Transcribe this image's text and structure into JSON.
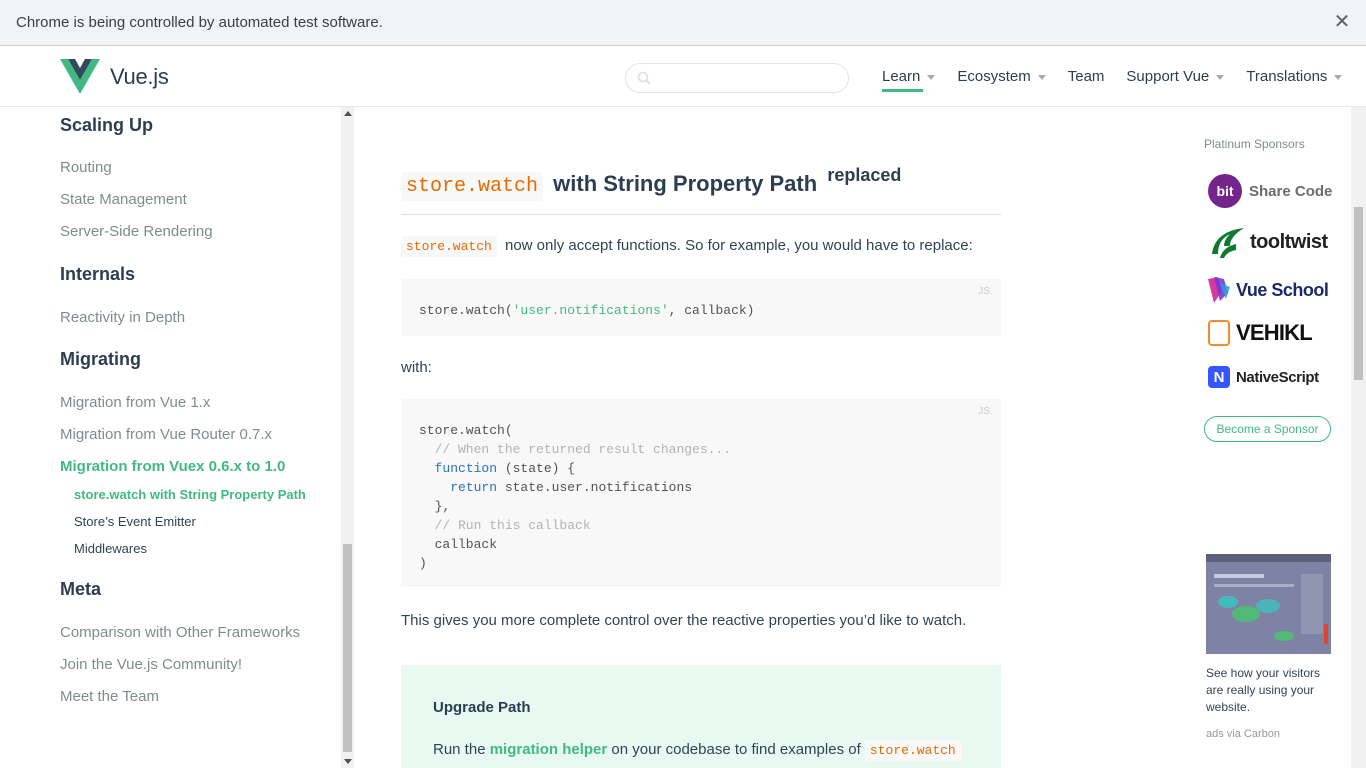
{
  "infobar": {
    "message": "Chrome is being controlled by automated test software.",
    "close": "✕"
  },
  "header": {
    "logo_text": "Vue.js",
    "search_placeholder": "",
    "nav": [
      {
        "label": "Learn",
        "has_dropdown": true,
        "active": true
      },
      {
        "label": "Ecosystem",
        "has_dropdown": true
      },
      {
        "label": "Team",
        "has_dropdown": false
      },
      {
        "label": "Support Vue",
        "has_dropdown": true
      },
      {
        "label": "Translations",
        "has_dropdown": true
      }
    ]
  },
  "sidebar": {
    "sections": [
      {
        "heading": "Scaling Up",
        "links": [
          "Routing",
          "State Management",
          "Server-Side Rendering"
        ]
      },
      {
        "heading": "Internals",
        "links": [
          "Reactivity in Depth"
        ]
      },
      {
        "heading": "Migrating",
        "links": [
          "Migration from Vue 1.x",
          "Migration from Vue Router 0.7.x",
          "Migration from Vuex 0.6.x to 1.0"
        ],
        "active_link": "Migration from Vuex 0.6.x to 1.0",
        "sublinks": [
          "store.watch with String Property Path",
          "Store’s Event Emitter",
          "Middlewares"
        ],
        "active_sublink": "store.watch with String Property Path"
      },
      {
        "heading": "Meta",
        "links": [
          "Comparison with Other Frameworks",
          "Join the Vue.js Community!",
          "Meet the Team"
        ]
      }
    ]
  },
  "main": {
    "heading_code": "store.watch",
    "heading_text": "with String Property Path",
    "heading_sup": "replaced",
    "intro_code": "store.watch",
    "intro_text": "now only accept functions. So for example, you would have to replace:",
    "code1": {
      "lang": "JS",
      "prefix": "store.watch(",
      "string": "'user.notifications'",
      "suffix": ", callback)"
    },
    "with_text": "with:",
    "code2": {
      "lang": "JS",
      "line1": "store.watch(",
      "line2": "  // When the returned result changes...",
      "line3_kw": "function",
      "line3_rest": " (state) {",
      "line4_kw": "return",
      "line4_rest": " state.user.notifications",
      "line5": "  },",
      "line6": "  // Run this callback",
      "line7": "  callback",
      "line8": ")"
    },
    "after_text": "This gives you more complete control over the reactive properties you’d like to watch.",
    "tip": {
      "title": "Upgrade Path",
      "text_before": "Run the",
      "link": "migration helper",
      "text_after": "on your codebase to find examples of",
      "code": "store.watch"
    }
  },
  "sponsors": {
    "label": "Platinum Sponsors",
    "items": [
      {
        "name": "Share Code",
        "badge": "bit"
      },
      {
        "name": "tooltwist"
      },
      {
        "name": "Vue School"
      },
      {
        "name": "VEHIKL"
      },
      {
        "name": "NativeScript"
      }
    ],
    "become_label": "Become a Sponsor",
    "carbon_text": "See how your visitors are really using your website.",
    "carbon_via": "ads via Carbon"
  },
  "colors": {
    "accent": "#42b983",
    "text": "#2c3e50",
    "code_orange": "#e96900"
  }
}
